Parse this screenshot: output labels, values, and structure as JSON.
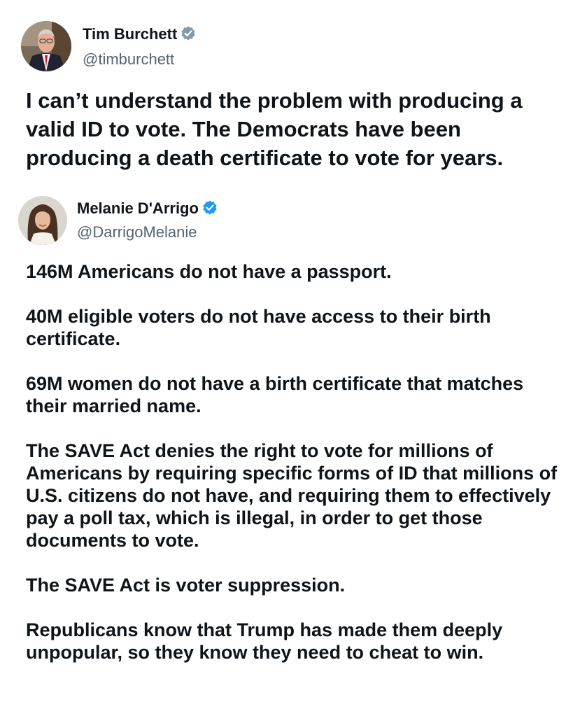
{
  "tweets": [
    {
      "author": {
        "name": "Tim Burchett",
        "handle": "@timburchett",
        "verified": true,
        "avatar_icon": "profile-photo-man-suit"
      },
      "text": "I can’t understand the problem with producing a valid ID to vote. The Democrats have been producing a death certificate to vote for years."
    },
    {
      "author": {
        "name": "Melanie D'Arrigo",
        "handle": "@DarrigoMelanie",
        "verified": true,
        "avatar_icon": "profile-photo-woman"
      },
      "paragraphs": [
        "146M Americans do not have a passport.",
        "40M eligible voters do not have access to their birth certificate.",
        "69M women do not have a birth certificate that matches their married name.",
        "The SAVE Act denies the right to vote for millions of Americans by requiring specific forms of ID that millions of U.S. citizens do not have, and requiring them to effectively pay a poll tax, which is illegal, in order to get those documents to vote.",
        "The SAVE Act is voter suppression.",
        "Republicans know that Trump has made them deeply unpopular, so they know they need to cheat to win."
      ]
    }
  ],
  "colors": {
    "text": "#0f1419",
    "handle": "#536471",
    "badge_gray": "#829aab",
    "badge_blue": "#1d9bf0",
    "background": "#ffffff"
  },
  "icons": {
    "badge_1": "gray-verified-badge-icon",
    "badge_2": "blue-verified-badge-icon"
  }
}
